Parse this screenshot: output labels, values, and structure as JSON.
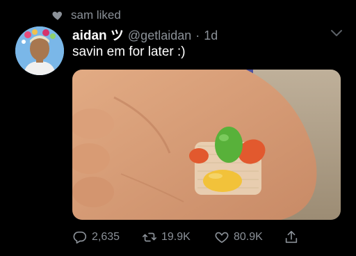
{
  "liked_by": {
    "text": "sam liked",
    "icon": "heart-icon"
  },
  "tweet": {
    "display_name": "aidan ツ",
    "handle": "@getlaidan",
    "separator": "·",
    "time": "1d",
    "text": "savin em for later :)",
    "media_alt": "photo of candies tucked under a bandage on a foot"
  },
  "actions": {
    "replies": "2,635",
    "retweets": "19.9K",
    "likes": "80.9K"
  },
  "colors": {
    "background": "#000000",
    "muted": "#8b9198",
    "text": "#ffffff"
  }
}
